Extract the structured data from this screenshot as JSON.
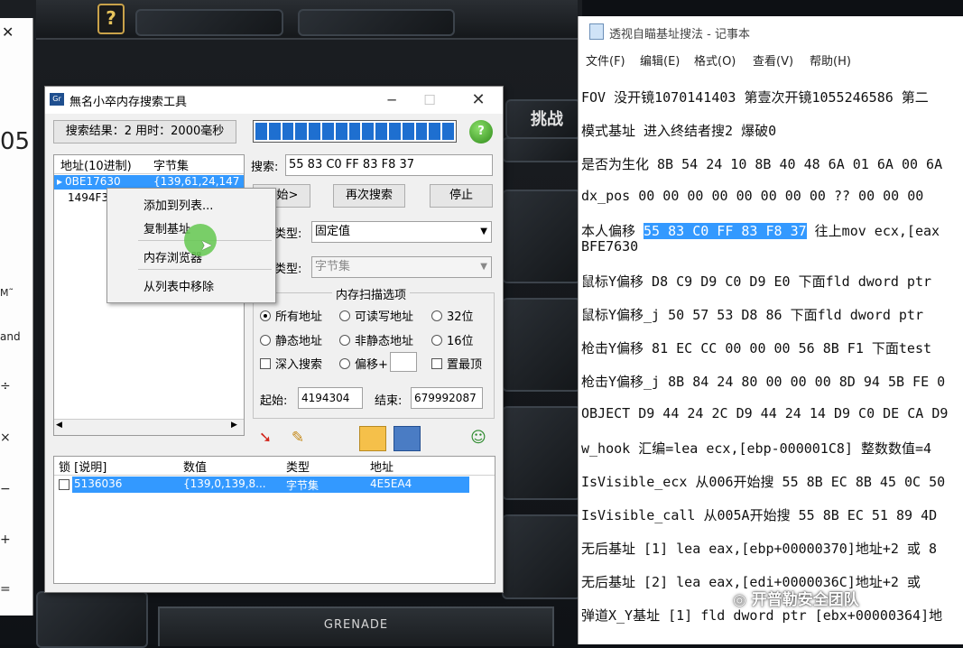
{
  "tool_window": {
    "title": "無名小卒内存搜索工具",
    "status": "搜索结果：2 用时：2000毫秒",
    "search_label": "搜索:",
    "search_value": "55 83 C0 FF 83 F8 37",
    "results_headers": [
      "地址(10进制)",
      "字节集"
    ],
    "results": [
      {
        "address": "0BE17630",
        "value": "{139,61,24,147"
      },
      {
        "address": "1494F3",
        "value": ""
      }
    ],
    "start_button": "开始>",
    "research_button": "再次搜索",
    "stop_button": "停止",
    "type1_label": "类型:",
    "type1_value": "固定值",
    "type2_label": "类型:",
    "type2_value": "字节集",
    "scan_group_title": "内存扫描选项",
    "opt_all": "所有地址",
    "opt_rw": "可读写地址",
    "opt_32": "32位",
    "opt_static": "静态地址",
    "opt_nonstatic": "非静态地址",
    "opt_16": "16位",
    "opt_deep": "深入搜索",
    "opt_offset": "偏移+",
    "opt_top": "置最顶",
    "start_addr_label": "起始:",
    "start_addr_value": "4194304",
    "end_addr_label": "结束:",
    "end_addr_value": "679992087",
    "context_menu": [
      "添加到列表...",
      "复制基址",
      "内存浏览器",
      "从列表中移除"
    ],
    "locked_headers": [
      "锁 [说明]",
      "数值",
      "类型",
      "地址"
    ],
    "locked_rows": [
      {
        "desc": "5136036",
        "value": "{139,0,139,8...",
        "type": "字节集",
        "address": "4E5EA4"
      }
    ]
  },
  "notepad": {
    "title": "透视自瞄基址搜法 - 记事本",
    "menu": [
      "文件(F)",
      "编辑(E)",
      "格式(O)",
      "查看(V)",
      "帮助(H)"
    ],
    "lines": [
      "FOV 没开镜1070141403 第壹次开镜1055246586 第二",
      "模式基址 进入终结者搜2 爆破0",
      "是否为生化 8B 54 24 10 8B 40 48 6A 01 6A 00 6A",
      "dx_pos 00 00 00 00 00 00 00 00 ?? 00 00 00",
      "本人偏移 ",
      "55 83 C0 FF 83 F8 37",
      " 往上mov ecx,[eax",
      "BFE7630",
      "鼠标Y偏移 D8 C9 D9 C0 D9 E0 下面fld dword ptr",
      "鼠标Y偏移_j  50 57 53 D8 86  下面fld dword ptr",
      "枪击Y偏移 81 EC CC 00 00 00 56 8B F1 下面test",
      "枪击Y偏移_j 8B 84 24 80 00 00 00 8D 94 5B FE 0",
      "OBJECT D9 44 24 2C D9 44 24 14 D9 C0 DE CA D9",
      "w_hook 汇编=lea ecx,[ebp-000001C8]  整数数值=4",
      "IsVisible_ecx 从006开始搜 55 8B EC 8B 45 0C 50",
      "IsVisible_call 从005A开始搜 55 8B EC 51 89 4D",
      "无后基址 [1] lea eax,[ebp+00000370]地址+2 或 8",
      "无后基址 [2]  lea eax,[edi+0000036C]地址+2   或",
      "弹道X_Y基址 [1] fld dword ptr [ebx+00000364]地"
    ]
  },
  "game": {
    "grenade_label": "GRENADE",
    "tiao_label": "挑战",
    "help_glyph": "?"
  },
  "left_window": {
    "close_glyph": "✕",
    "big_text": "05",
    "small1": "M˜",
    "small2": "and",
    "op1": "÷",
    "op2": "×",
    "op3": "−",
    "op4": "+",
    "op5": "="
  },
  "watermark": "开普勒安全团队"
}
